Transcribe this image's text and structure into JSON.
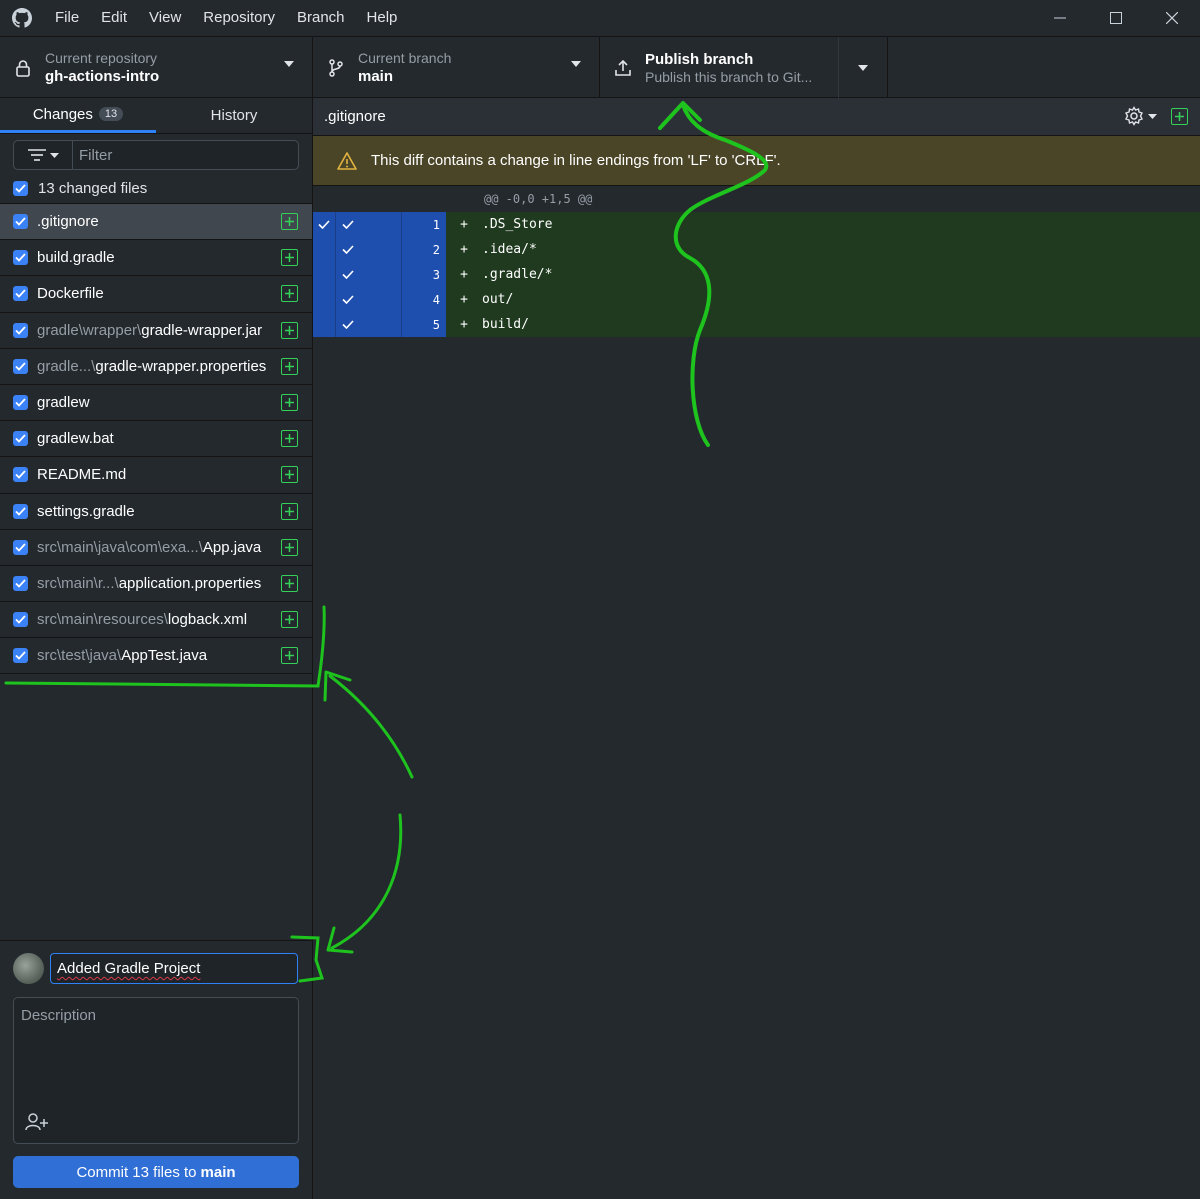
{
  "menu": [
    "File",
    "Edit",
    "View",
    "Repository",
    "Branch",
    "Help"
  ],
  "toolbar": {
    "repo_label": "Current repository",
    "repo_name": "gh-actions-intro",
    "branch_label": "Current branch",
    "branch_name": "main",
    "publish_title": "Publish branch",
    "publish_desc": "Publish this branch to Git..."
  },
  "sidebar": {
    "tab_changes": "Changes",
    "tab_changes_count": "13",
    "tab_history": "History",
    "filter_placeholder": "Filter",
    "changed_files_label": "13 changed files",
    "files": [
      {
        "dir": "",
        "name": ".gitignore"
      },
      {
        "dir": "",
        "name": "build.gradle"
      },
      {
        "dir": "",
        "name": "Dockerfile"
      },
      {
        "dir": "gradle\\wrapper\\",
        "name": "gradle-wrapper.jar"
      },
      {
        "dir": "gradle...\\",
        "name": "gradle-wrapper.properties"
      },
      {
        "dir": "",
        "name": "gradlew"
      },
      {
        "dir": "",
        "name": "gradlew.bat"
      },
      {
        "dir": "",
        "name": "README.md"
      },
      {
        "dir": "",
        "name": "settings.gradle"
      },
      {
        "dir": "src\\main\\java\\com\\exa...\\",
        "name": "App.java"
      },
      {
        "dir": "src\\main\\r...\\",
        "name": "application.properties"
      },
      {
        "dir": "src\\main\\resources\\",
        "name": "logback.xml"
      },
      {
        "dir": "src\\test\\java\\",
        "name": "AppTest.java"
      }
    ]
  },
  "commit": {
    "summary": "Added Gradle Project",
    "description_placeholder": "Description",
    "button_prefix": "Commit 13 files to",
    "button_branch": "main"
  },
  "diff": {
    "filename": ".gitignore",
    "warning": "This diff contains a change in line endings from 'LF' to 'CRLF'.",
    "hunk": "@@ -0,0 +1,5 @@",
    "lines": [
      {
        "num": "1",
        "text": ".DS_Store"
      },
      {
        "num": "2",
        "text": ".idea/*"
      },
      {
        "num": "3",
        "text": ".gradle/*"
      },
      {
        "num": "4",
        "text": "out/"
      },
      {
        "num": "5",
        "text": "build/"
      }
    ]
  },
  "colors": {
    "accent": "#2f81f7",
    "added_green": "#34d058",
    "annotation_green": "#1ec31e"
  }
}
